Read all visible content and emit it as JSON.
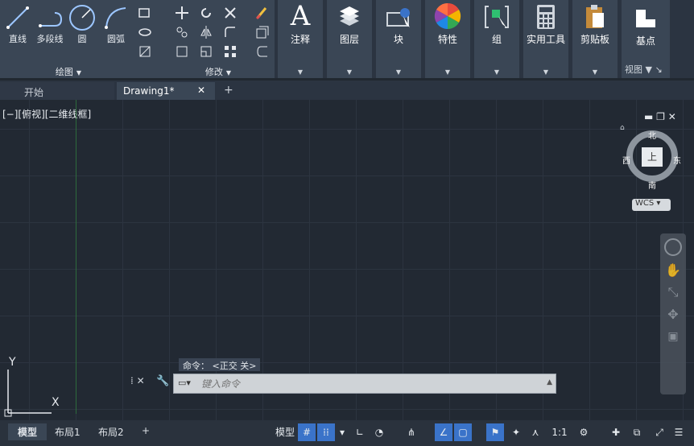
{
  "ribbon": {
    "draw": {
      "line": "直线",
      "polyline": "多段线",
      "circle": "圆",
      "arc": "圆弧",
      "panel": "绘图"
    },
    "modify": {
      "panel": "修改"
    },
    "big": [
      {
        "label": "注释",
        "icon": "text-A-icon"
      },
      {
        "label": "图层",
        "icon": "layers-icon"
      },
      {
        "label": "块",
        "icon": "block-icon"
      },
      {
        "label": "特性",
        "icon": "color-wheel-icon"
      },
      {
        "label": "组",
        "icon": "group-icon"
      },
      {
        "label": "实用工具",
        "icon": "calculator-icon"
      },
      {
        "label": "剪贴板",
        "icon": "clipboard-icon"
      },
      {
        "label": "基点",
        "icon": "base-point-icon"
      }
    ],
    "view_panel": "视图"
  },
  "tabs": {
    "start": "开始",
    "drawing": "Drawing1*"
  },
  "viewport": {
    "label": "[−][俯视][二维线框]",
    "compass": {
      "north": "北",
      "south": "南",
      "east": "东",
      "west": "西",
      "center": "上"
    },
    "wcs": "WCS",
    "ucs_y": "Y",
    "ucs_x": "X"
  },
  "command": {
    "hint": "命令： <正交 关>",
    "placeholder": "键入命令"
  },
  "status": {
    "model_tab": "模型",
    "layout1": "布局1",
    "layout2": "布局2",
    "model_btn": "模型",
    "scale": "1:1"
  },
  "colors": {
    "accent": "#3a73c9",
    "ribbon": "#3a4655",
    "canvas": "#222933"
  }
}
